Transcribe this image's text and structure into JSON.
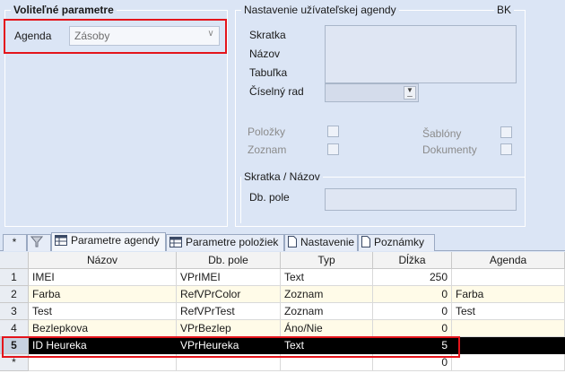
{
  "optional_params": {
    "title": "Voliteľné parametre",
    "agenda_label": "Agenda",
    "agenda_value": "Zásoby"
  },
  "user_agenda": {
    "title": "Nastavenie užívateľskej agendy",
    "code": "BK",
    "fields": [
      "Skratka",
      "Názov",
      "Tabuľka",
      "Číselný rad"
    ],
    "checks_left": [
      "Položky",
      "Zoznam"
    ],
    "checks_right": [
      "Šablóny",
      "Dokumenty"
    ]
  },
  "short_name": {
    "title": "Skratka / Názov",
    "db_pole_label": "Db. pole"
  },
  "tabs": [
    {
      "icon": "filter-icon",
      "label": ""
    },
    {
      "icon": "grid-icon",
      "label": "Parametre agendy"
    },
    {
      "icon": "grid-icon",
      "label": "Parametre položiek"
    },
    {
      "icon": "doc-icon",
      "label": "Nastavenie"
    },
    {
      "icon": "doc-icon",
      "label": "Poznámky"
    }
  ],
  "grid": {
    "corner": "*",
    "columns": [
      "Názov",
      "Db. pole",
      "Typ",
      "Dĺžka",
      "Agenda"
    ],
    "rows": [
      {
        "n": "1",
        "cells": [
          "IMEI",
          "VPrIMEI",
          "Text",
          "250",
          ""
        ]
      },
      {
        "n": "2",
        "cells": [
          "Farba",
          "RefVPrColor",
          "Zoznam",
          "0",
          "Farba"
        ]
      },
      {
        "n": "3",
        "cells": [
          "Test",
          "RefVPrTest",
          "Zoznam",
          "0",
          "Test"
        ]
      },
      {
        "n": "4",
        "cells": [
          "Bezlepkova",
          "VPrBezlep",
          "Áno/Nie",
          "0",
          ""
        ]
      },
      {
        "n": "5",
        "cells": [
          "ID Heureka",
          "VPrHeureka",
          "Text",
          "5",
          ""
        ]
      },
      {
        "n": "*",
        "cells": [
          "",
          "",
          "",
          "0",
          ""
        ]
      }
    ],
    "selected_row": 5
  },
  "colors": {
    "background": "#dbe5f5",
    "highlight": "#e4141b",
    "selected_row": "#000000",
    "alt_row": "#fffbe8"
  }
}
